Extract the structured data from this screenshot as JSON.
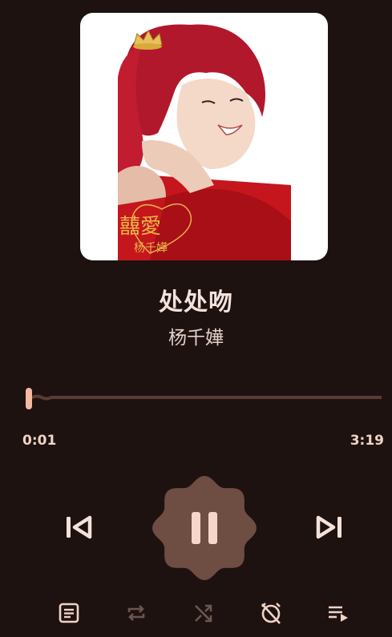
{
  "track": {
    "title": "处处吻",
    "artist": "杨千嬅",
    "album_art_text": {
      "title_glyphs": "囍愛",
      "artist_glyphs": "杨千嬅"
    }
  },
  "progress": {
    "current_time": "0:01",
    "total_time": "3:19",
    "fraction": 0.005
  },
  "controls": {
    "previous_icon": "skip-previous-icon",
    "play_state": "playing",
    "pause_icon": "pause-icon",
    "next_icon": "skip-next-icon"
  },
  "toolbar": {
    "lyrics_icon": "lyrics-icon",
    "repeat_icon": "repeat-icon",
    "shuffle_icon": "shuffle-icon",
    "sleep_timer_icon": "timer-off-icon",
    "queue_icon": "queue-icon"
  },
  "colors": {
    "background": "#1d1210",
    "accent": "#f4b9a1",
    "play_button": "#6e4d43",
    "text_primary": "#f3e2dc",
    "icon_active": "#f1d2c6",
    "icon_disabled": "#6d5550"
  }
}
